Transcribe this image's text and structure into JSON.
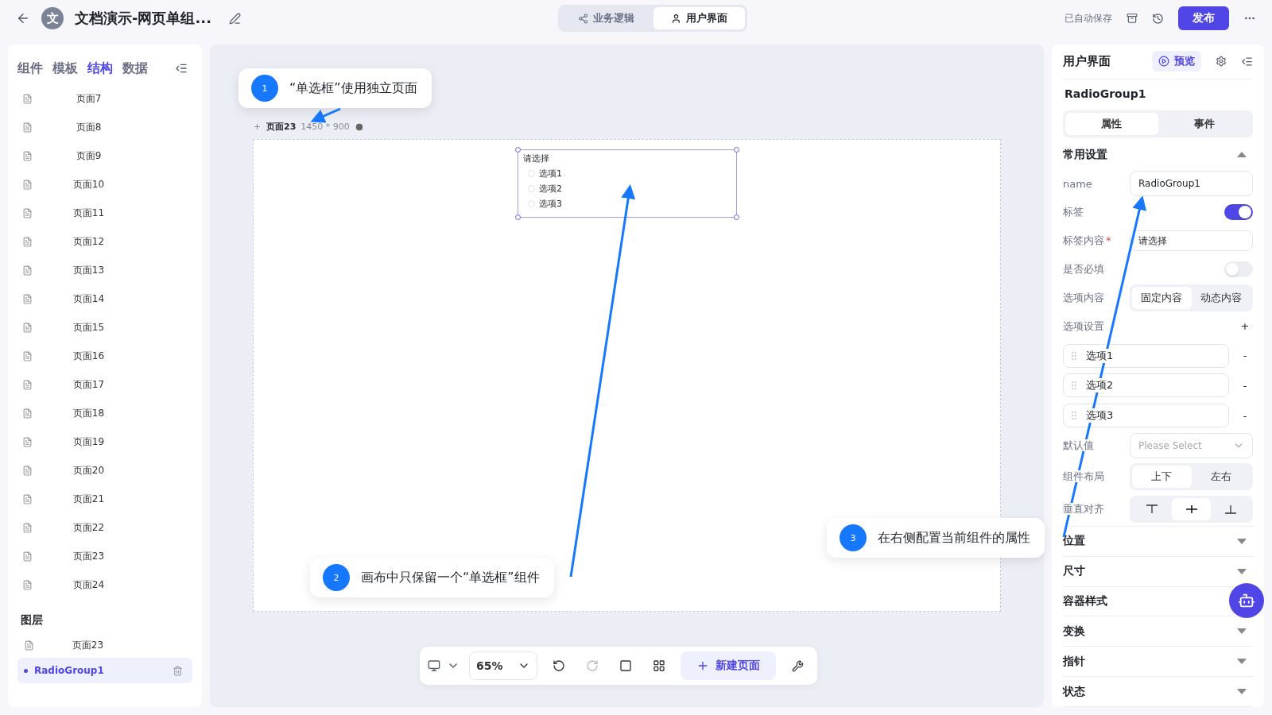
{
  "topbar": {
    "app_initial": "文",
    "title": "文档演示-网页单组...",
    "modes": [
      {
        "label": "业务逻辑",
        "selected": false
      },
      {
        "label": "用户界面",
        "selected": true
      }
    ],
    "save_status": "已自动保存",
    "publish": "发布"
  },
  "left_panel": {
    "tabs": [
      {
        "label": "组件",
        "selected": false
      },
      {
        "label": "模板",
        "selected": false
      },
      {
        "label": "结构",
        "selected": true
      },
      {
        "label": "数据",
        "selected": false
      }
    ],
    "pages": [
      "页面7",
      "页面8",
      "页面9",
      "页面10",
      "页面11",
      "页面12",
      "页面13",
      "页面14",
      "页面15",
      "页面16",
      "页面17",
      "页面18",
      "页面19",
      "页面20",
      "页面21",
      "页面22",
      "页面23",
      "页面24"
    ],
    "layers_title": "图层",
    "layers": [
      {
        "label": "页面23",
        "kind": "page",
        "selected": false
      },
      {
        "label": "RadioGroup1",
        "kind": "component",
        "selected": true
      }
    ]
  },
  "canvas": {
    "page_name": "页面23",
    "page_size": "1450 * 900",
    "radio_group": {
      "label": "请选择",
      "options": [
        {
          "label": "选项1",
          "selected": false
        },
        {
          "label": "选项2",
          "selected": false
        },
        {
          "label": "选项3",
          "selected": false
        }
      ]
    }
  },
  "toolbar": {
    "zoom": "65%",
    "new_page": "新建页面"
  },
  "right_panel": {
    "title": "用户界面",
    "preview": "预览",
    "component_name": "RadioGroup1",
    "tabs": [
      {
        "label": "属性",
        "selected": true
      },
      {
        "label": "事件",
        "selected": false
      }
    ],
    "section": {
      "title": "常用设置",
      "expanded": true
    },
    "name_label": "name",
    "name_value": "RadioGroup1",
    "label_toggle": {
      "label": "标签",
      "on": true
    },
    "label_content": {
      "label": "标签内容",
      "required_mark": "*",
      "value": "请选择"
    },
    "required_toggle": {
      "label": "是否必填",
      "on": false
    },
    "option_source": {
      "label": "选项内容",
      "choices": [
        {
          "label": "固定内容",
          "selected": true
        },
        {
          "label": "动态内容",
          "selected": false
        }
      ]
    },
    "option_settings": {
      "label": "选项设置",
      "add": "+",
      "items": [
        {
          "value": "选项1",
          "remove": "-"
        },
        {
          "value": "选项2",
          "remove": "-"
        },
        {
          "value": "选项3",
          "remove": "-"
        }
      ]
    },
    "default_value": {
      "label": "默认值",
      "placeholder": "Please Select"
    },
    "layout": {
      "label": "组件布局",
      "choices": [
        {
          "label": "上下",
          "selected": true
        },
        {
          "label": "左右",
          "selected": false
        }
      ]
    },
    "vertical_align": {
      "label": "垂直对齐",
      "choices": [
        {
          "selected": false
        },
        {
          "selected": true
        },
        {
          "selected": false
        }
      ]
    },
    "collapsed_sections": [
      {
        "title": "位置",
        "expanded": false
      },
      {
        "title": "尺寸",
        "expanded": false
      },
      {
        "title": "容器样式"
      },
      {
        "title": "变换",
        "expanded": false
      },
      {
        "title": "指针",
        "expanded": false
      },
      {
        "title": "状态",
        "expanded": false
      }
    ]
  },
  "callouts": [
    {
      "number": "1",
      "text": "“单选框”使用独立页面"
    },
    {
      "number": "2",
      "text": "画布中只保留一个“单选框”组件"
    },
    {
      "number": "3",
      "text": "在右侧配置当前组件的属性"
    }
  ]
}
